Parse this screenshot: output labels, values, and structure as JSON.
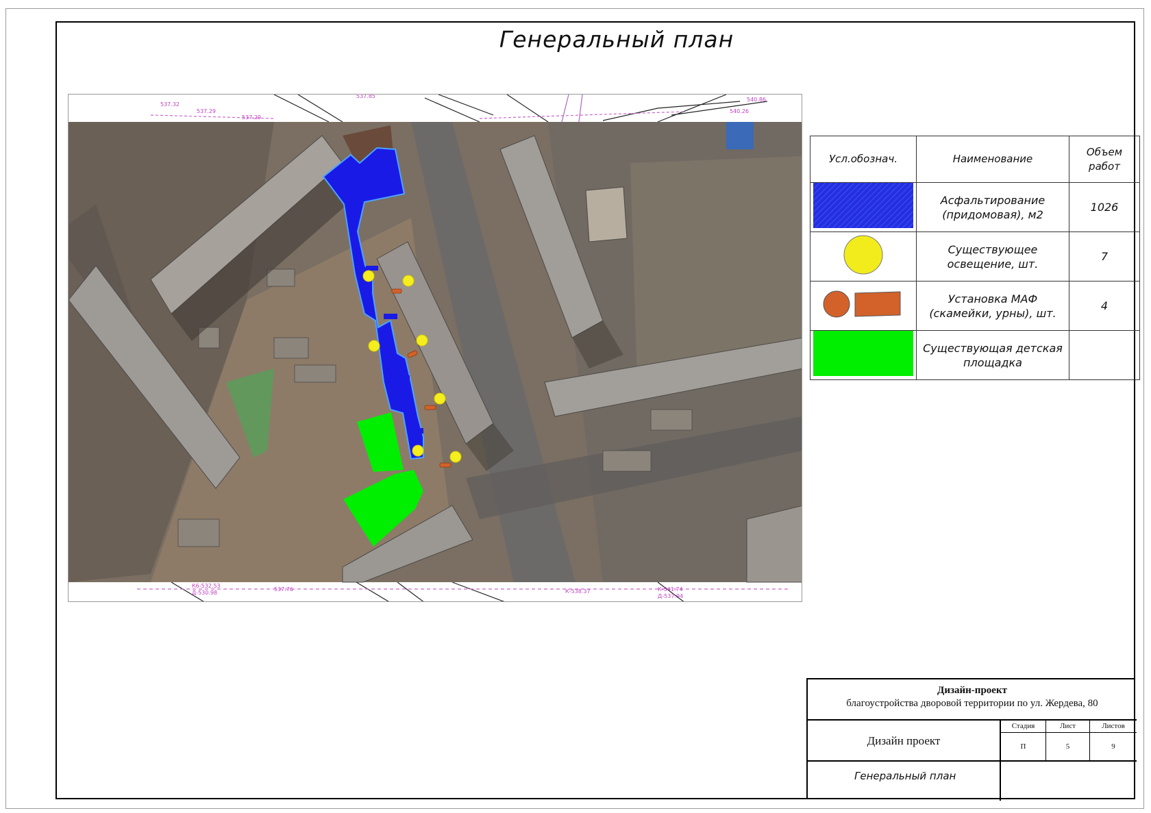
{
  "sheet_title": "Генеральный план",
  "legend": {
    "headers": {
      "symbol": "Усл.обознач.",
      "name": "Наименование",
      "volume": "Объем работ"
    },
    "rows": [
      {
        "name": "Асфальтирование (придомовая), м2",
        "volume": "1026",
        "symbol": "blue-hatched-fill",
        "color": "#2430e0"
      },
      {
        "name": "Существующее освещение, шт.",
        "volume": "7",
        "symbol": "yellow-circle",
        "color": "#f2ec1c"
      },
      {
        "name": "Установка МАФ (скамейки, урны), шт.",
        "volume": "4",
        "symbol": "orange-circle-and-rectangle",
        "color": "#d2622a"
      },
      {
        "name": "Существующая детская площадка",
        "volume": "",
        "symbol": "green-fill",
        "color": "#00ef00"
      }
    ]
  },
  "title_block": {
    "project": "Дизайн-проект",
    "subject": "благоустройства дворовой территории по ул. Жердева, 80",
    "stage_name": "Дизайн проект",
    "stage_header": "Стадия",
    "stage_value": "П",
    "sheet_header": "Лист",
    "sheet_value": "5",
    "sheets_header": "Листов",
    "sheets_value": "9",
    "drawing_name": "Генеральный план"
  },
  "colors": {
    "asphalt": "#1a1ae6",
    "lighting": "#f5ee1e",
    "maf": "#d2622a",
    "playground": "#00ee00"
  }
}
